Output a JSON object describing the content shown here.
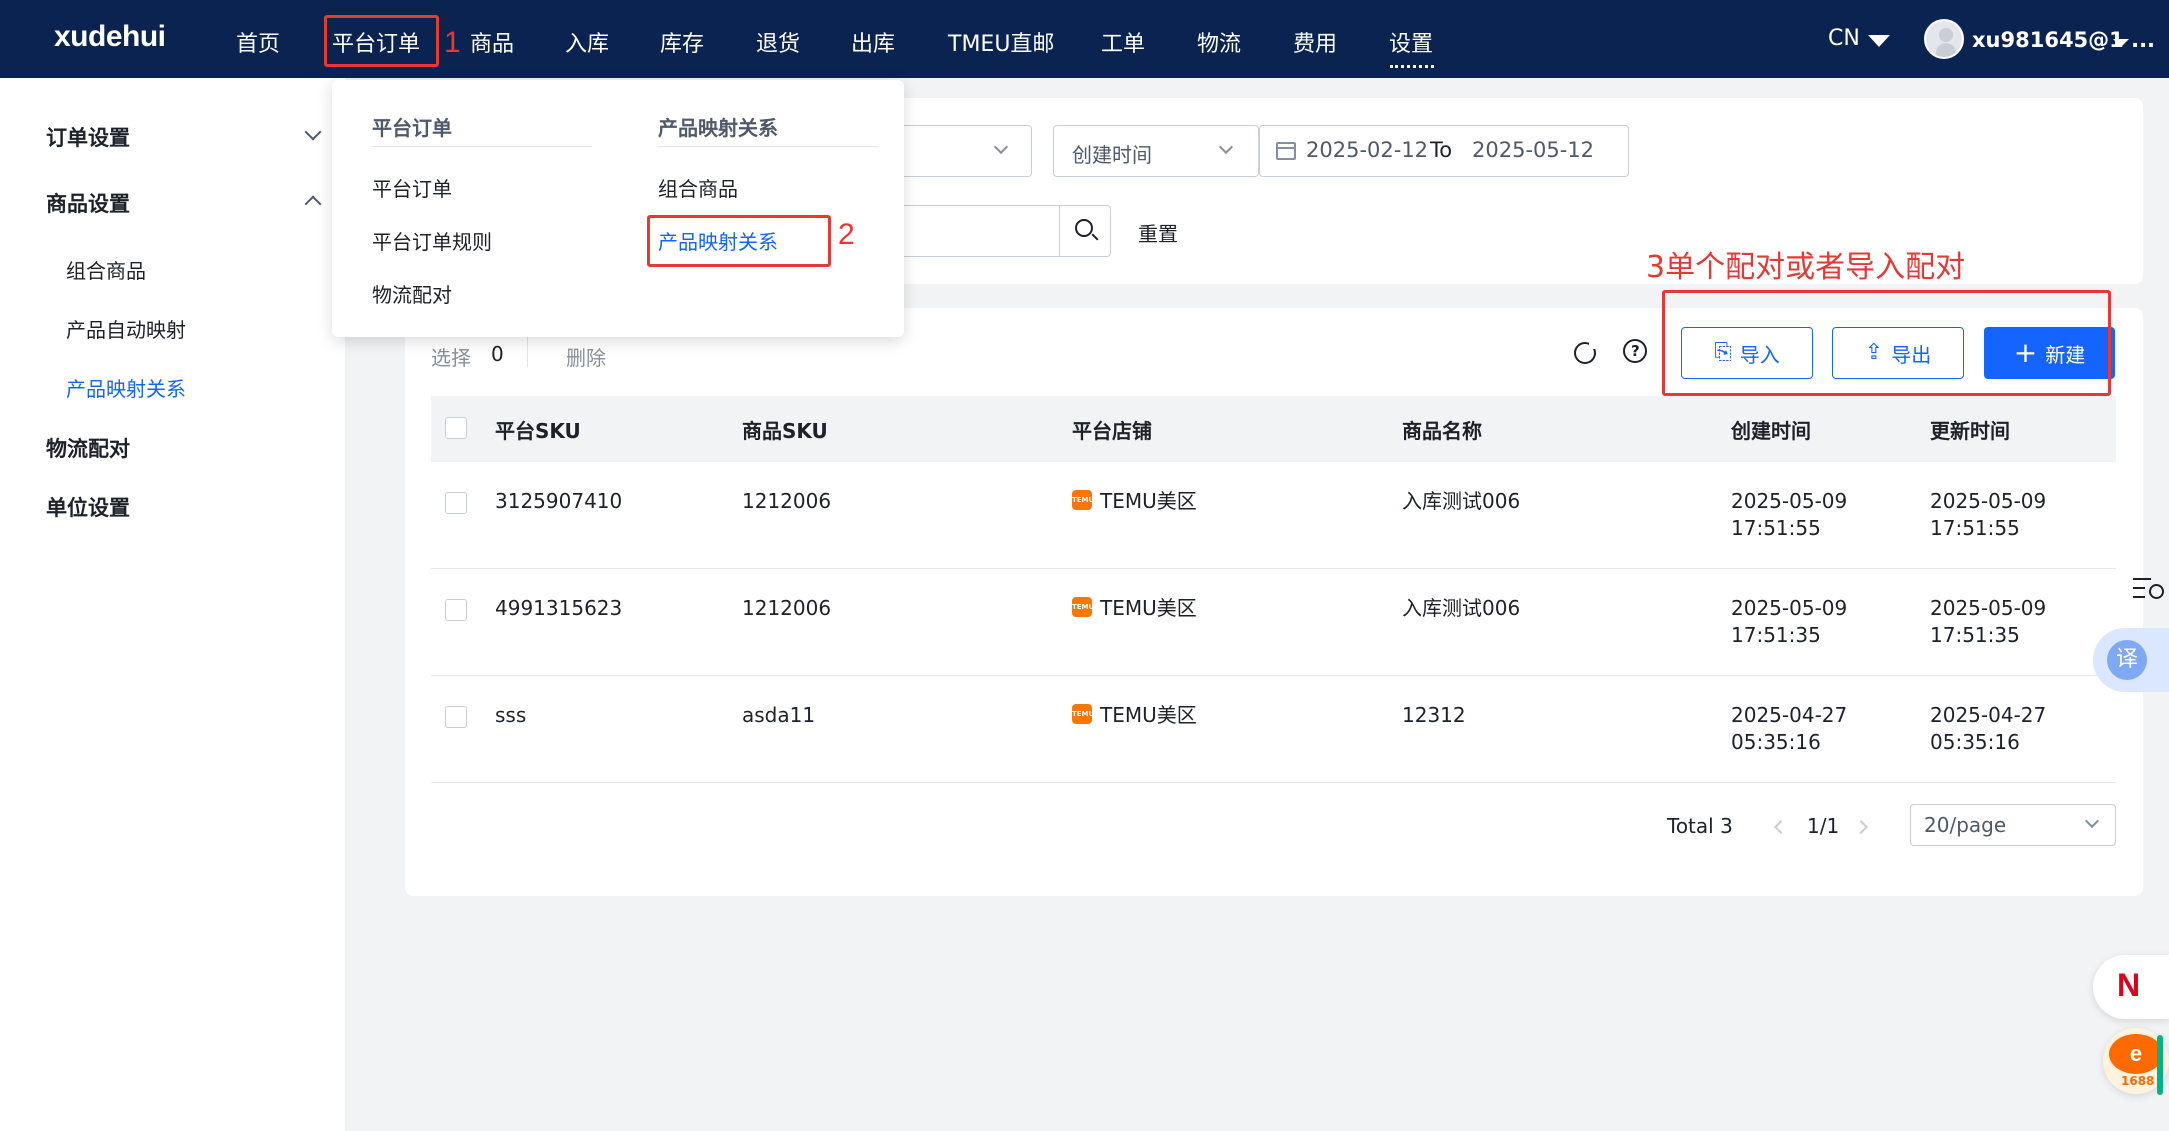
{
  "app": {
    "logo": "xudehui"
  },
  "nav": {
    "items": [
      "首页",
      "平台订单",
      "商品",
      "入库",
      "库存",
      "退货",
      "出库",
      "TMEU直邮",
      "工单",
      "物流",
      "费用",
      "设置"
    ],
    "active": "设置",
    "lang": "CN",
    "user": "xu981645@1 ..."
  },
  "annotations": {
    "n1": "1",
    "n2": "2",
    "n3": "3单个配对或者导入配对"
  },
  "sidebar": {
    "order_settings": "订单设置",
    "product_settings": "商品设置",
    "sub": [
      "组合商品",
      "产品自动映射",
      "产品映射关系"
    ],
    "active_sub": "产品映射关系",
    "logistics": "物流配对",
    "unit": "单位设置"
  },
  "dropdown": {
    "col1_head": "平台订单",
    "col1_items": [
      "平台订单",
      "平台订单规则",
      "物流配对"
    ],
    "col2_head": "产品映射关系",
    "col2_items": [
      "组合商品",
      "产品映射关系"
    ],
    "active_item": "产品映射关系"
  },
  "filters": {
    "time_select": "创建时间",
    "date_from": "2025-02-12",
    "date_sep": "To",
    "date_to": "2025-05-12",
    "reset": "重置"
  },
  "toolbar": {
    "select_label": "选择",
    "select_count": "0",
    "delete": "删除",
    "import": "导入",
    "export": "导出",
    "new": "新建",
    "help": "?"
  },
  "table": {
    "headers": [
      "平台SKU",
      "商品SKU",
      "平台店铺",
      "商品名称",
      "创建时间",
      "更新时间"
    ],
    "rows": [
      {
        "platform_sku": "3125907410",
        "product_sku": "1212006",
        "shop": "TEMU美区",
        "name": "入库测试006",
        "created_date": "2025-05-09",
        "created_time": "17:51:55",
        "updated_date": "2025-05-09",
        "updated_time": "17:51:55"
      },
      {
        "platform_sku": "4991315623",
        "product_sku": "1212006",
        "shop": "TEMU美区",
        "name": "入库测试006",
        "created_date": "2025-05-09",
        "created_time": "17:51:35",
        "updated_date": "2025-05-09",
        "updated_time": "17:51:35"
      },
      {
        "platform_sku": "sss",
        "product_sku": "asda11",
        "shop": "TEMU美区",
        "name": "12312",
        "created_date": "2025-04-27",
        "created_time": "05:35:16",
        "updated_date": "2025-04-27",
        "updated_time": "05:35:16"
      }
    ]
  },
  "pager": {
    "total": "Total 3",
    "page": "1/1",
    "size": "20/page"
  },
  "float": {
    "translate": "译",
    "n": "N",
    "logo_1688": "1688"
  },
  "colors": {
    "nav_bg": "#0b2350",
    "primary": "#1664ff",
    "annotation_red": "#e53935",
    "temu_orange": "#fb7701"
  }
}
